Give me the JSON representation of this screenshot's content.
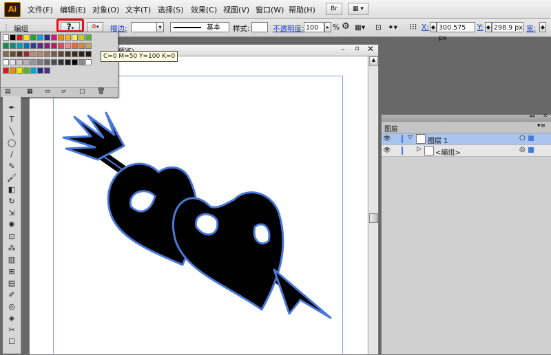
{
  "app": {
    "logo": "Ai"
  },
  "menus": [
    {
      "label": "文件(F)"
    },
    {
      "label": "编辑(E)"
    },
    {
      "label": "对象(O)"
    },
    {
      "label": "文字(T)"
    },
    {
      "label": "选择(S)"
    },
    {
      "label": "效果(C)"
    },
    {
      "label": "视图(V)"
    },
    {
      "label": "窗口(W)"
    },
    {
      "label": "帮助(H)"
    }
  ],
  "menubar_buttons": {
    "bridge": "Br",
    "arrange": "▦ ▾"
  },
  "control_bar": {
    "selection_label": "编组",
    "fill_glyph": "?",
    "stroke_label": "描边:",
    "stroke_profile": "基本",
    "style_label": "样式:",
    "opacity_label": "不透明度:",
    "opacity_value": "100",
    "opacity_unit": "%",
    "x_label": "X:",
    "x_value": "300.575 px",
    "y_label": "Y:",
    "y_value": "298.9 px",
    "width_label": "宽:"
  },
  "tooltip": {
    "text": "C=0 M=50 Y=100 K=0"
  },
  "document": {
    "title": "预览)"
  },
  "swatches": {
    "row1": [
      "#ffffff",
      "#000000",
      "#e8141b",
      "#f7e400",
      "#1aa53a",
      "#00a3e0",
      "#1f2d8f",
      "#e2127d",
      "#f28c00",
      "#f7b500",
      "#f6ec63",
      "#c3d600",
      "#58b22e"
    ],
    "row2": [
      "#0c9447",
      "#0b8e7e",
      "#00a0b0",
      "#0b6fb8",
      "#2d3e99",
      "#5a2a86",
      "#8b1d7a",
      "#c2185b",
      "#e5485c",
      "#f08c8c",
      "#ef6c2f",
      "#d98a3a",
      "#c4a35a"
    ],
    "row3": [
      "#8d6b3a",
      "#6d4b25",
      "#523312",
      "#9c2a2a",
      "#bf8c78",
      "#b88a62",
      "#9c7a55",
      "#7e5e3f",
      "#5f4630",
      "#4a3626",
      "#3d2d1e",
      "#2d2118",
      "#2a1a10"
    ],
    "row4": [
      "#ffffff",
      "#e6e6e6",
      "#cccccc",
      "#b3b3b3",
      "#999999",
      "#808080",
      "#666666",
      "#4d4d4d",
      "#333333",
      "#1a1a1a",
      "#000000",
      "#8a8a8a",
      "#ffffff"
    ],
    "row5": [
      "#e8141b",
      "#f28c00",
      "#f7e400",
      "#58b22e",
      "#00a3e0",
      "#1f2d8f",
      "#5a2a86"
    ]
  },
  "tools": [
    {
      "icon": "pen-icon",
      "glyph": "✒"
    },
    {
      "icon": "type-icon",
      "glyph": "T"
    },
    {
      "icon": "line-icon",
      "glyph": "╲"
    },
    {
      "icon": "ellipse-icon",
      "glyph": "◯"
    },
    {
      "icon": "brush-icon",
      "glyph": "/"
    },
    {
      "icon": "pencil-icon",
      "glyph": "✎"
    },
    {
      "icon": "blob-brush-icon",
      "glyph": "🖌"
    },
    {
      "icon": "eraser-icon",
      "glyph": "◧"
    },
    {
      "icon": "rotate-icon",
      "glyph": "↻"
    },
    {
      "icon": "scale-icon",
      "glyph": "⇲"
    },
    {
      "icon": "warp-icon",
      "glyph": "✺"
    },
    {
      "icon": "free-transform-icon",
      "glyph": "⊡"
    },
    {
      "icon": "symbol-sprayer-icon",
      "glyph": "⁂"
    },
    {
      "icon": "graph-icon",
      "glyph": "▥"
    },
    {
      "icon": "mesh-icon",
      "glyph": "⊞"
    },
    {
      "icon": "gradient-icon",
      "glyph": "▤"
    },
    {
      "icon": "eyedropper-icon",
      "glyph": "✐"
    },
    {
      "icon": "blend-icon",
      "glyph": "◎"
    },
    {
      "icon": "live-paint-icon",
      "glyph": "◈"
    },
    {
      "icon": "slice-icon",
      "glyph": "✂"
    },
    {
      "icon": "artboard-icon",
      "glyph": "☐"
    }
  ],
  "layers_panel": {
    "tab_label": "图层",
    "layers": [
      {
        "name": "图层 1",
        "selected": true
      },
      {
        "name": "<编组>",
        "selected": false
      }
    ]
  },
  "colors": {
    "accent_blue": "#4a78d9",
    "selection_row": "#aac4f0",
    "highlight_red": "#e01010"
  }
}
